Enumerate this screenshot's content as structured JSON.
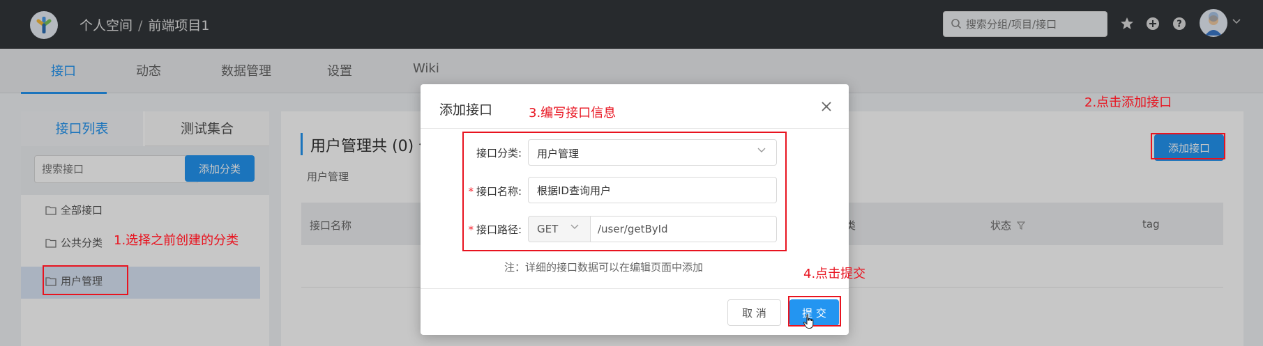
{
  "header": {
    "breadcrumb_space": "个人空间",
    "breadcrumb_sep": "/",
    "breadcrumb_project": "前端项目1",
    "search_placeholder": "搜索分组/项目/接口"
  },
  "nav": {
    "tabs": [
      {
        "label": "接口"
      },
      {
        "label": "动态"
      },
      {
        "label": "数据管理"
      },
      {
        "label": "设置"
      },
      {
        "label": "Wiki"
      }
    ]
  },
  "left": {
    "tabs": [
      {
        "label": "接口列表"
      },
      {
        "label": "测试集合"
      }
    ],
    "search_placeholder": "搜索接口",
    "add_category_label": "添加分类",
    "tree": [
      {
        "label": "全部接口"
      },
      {
        "label": "公共分类"
      },
      {
        "label": "用户管理"
      }
    ]
  },
  "main": {
    "title": "用户管理共 (0) 个",
    "subtitle": "用户管理",
    "add_api_label": "添加接口",
    "columns": [
      "接口名称",
      "类",
      "状态",
      "tag"
    ]
  },
  "modal": {
    "title": "添加接口",
    "fields": {
      "category_label": "接口分类:",
      "category_value": "用户管理",
      "name_label": "接口名称:",
      "name_value": "根据ID查询用户",
      "path_label": "接口路径:",
      "method_value": "GET",
      "path_value": "/user/getById",
      "required_mark": "*"
    },
    "note": "注：详细的接口数据可以在编辑页面中添加",
    "cancel_label": "取 消",
    "submit_label": "提 交"
  },
  "annotations": {
    "step1": "1.选择之前创建的分类",
    "step2": "2.点击添加接口",
    "step3": "3.编写接口信息",
    "step4": "4.点击提交",
    "color": "#e8131f"
  },
  "colors": {
    "primary": "#2395f1",
    "header_bg": "#32363a"
  }
}
